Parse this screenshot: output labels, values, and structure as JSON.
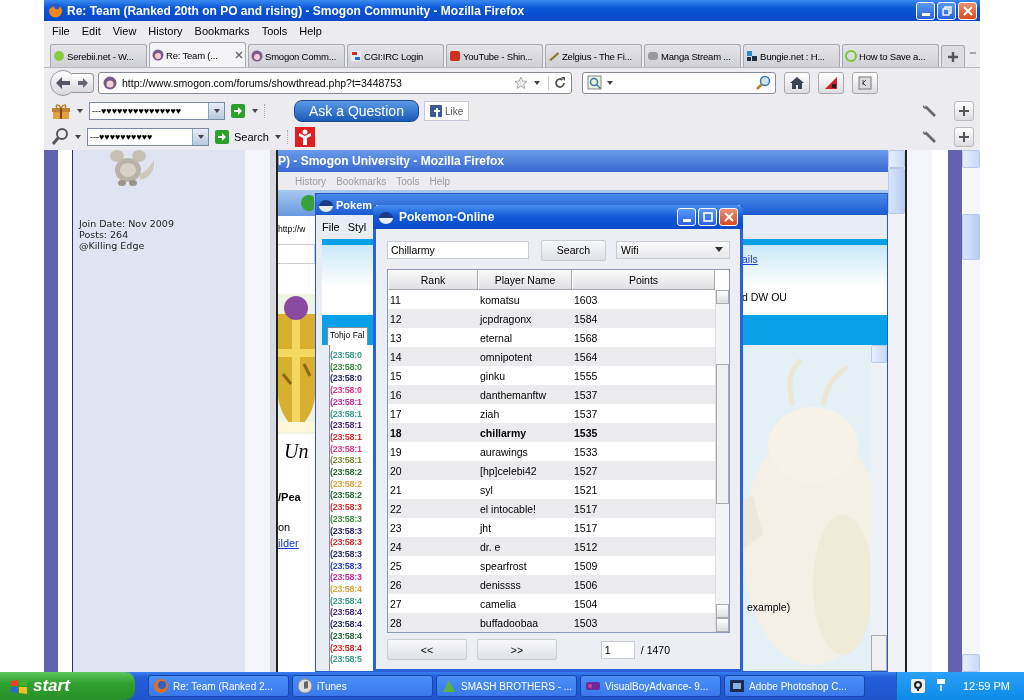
{
  "browser": {
    "title": "Re: Team (Ranked 20th on PO and rising) - Smogon Community - Mozilla Firefox",
    "menu": [
      "File",
      "Edit",
      "View",
      "History",
      "Bookmarks",
      "Tools",
      "Help"
    ],
    "tabs": [
      {
        "label": "Serebii.net - W...",
        "selected": false
      },
      {
        "label": "Re: Team (...",
        "selected": true
      },
      {
        "label": "Smogon Comm...",
        "selected": false
      },
      {
        "label": "CGI:IRC Login",
        "selected": false
      },
      {
        "label": "YouTube - Shin...",
        "selected": false
      },
      {
        "label": "Zelgius - The Fi...",
        "selected": false
      },
      {
        "label": "Manga Stream ...",
        "selected": false
      },
      {
        "label": "Bungie.net : H...",
        "selected": false
      },
      {
        "label": "How to Save a...",
        "selected": false
      }
    ],
    "address": "http://www.smogon.com/forums/showthread.php?t=3448753",
    "toolbar_1": {
      "dropdown": "---♥♥♥♥♥♥♥♥♥♥♥♥♥♥♥",
      "ask_button": "Ask a Question",
      "like_button": "Like"
    },
    "toolbar_2": {
      "dropdown": "---♥♥♥♥♥♥♥♥♥♥",
      "search_button": "Search"
    }
  },
  "post": {
    "user_info": [
      "Join Date: Nov 2009",
      "Posts: 264",
      "@Killing Edge"
    ]
  },
  "inner_browser": {
    "title": "P) - Smogon University - Mozilla Firefox",
    "menu": [
      "History",
      "Bookmarks",
      "Tools",
      "Help"
    ],
    "fragments": [
      {
        "kind": "url",
        "text": "http://w"
      },
      {
        "kind": "heading",
        "text": "Un"
      },
      {
        "kind": "bold",
        "text": "/Pea"
      },
      {
        "kind": "text",
        "text": "on"
      },
      {
        "kind": "link",
        "text": "ilder"
      }
    ]
  },
  "client_window": {
    "title": "Pokem",
    "menu": [
      "File",
      "Styl"
    ],
    "link": "ails",
    "tier_text": "d DW OU",
    "chat_tab": "Tohjo Fal",
    "chat_text": "example)",
    "chat_log": [
      {
        "text": "(23:58:0",
        "color": "#3a9a8a"
      },
      {
        "text": "(23:58:0",
        "color": "#3d8a3d"
      },
      {
        "text": "(23:58:0",
        "color": "#2a2a6a"
      },
      {
        "text": "(23:58:0",
        "color": "#d83a8a"
      },
      {
        "text": "(23:58:1",
        "color": "#c02f9a"
      },
      {
        "text": "(23:58:1",
        "color": "#3a9a8a"
      },
      {
        "text": "(23:58:1",
        "color": "#4a2a7a"
      },
      {
        "text": "(23:58:1",
        "color": "#d03030"
      },
      {
        "text": "(23:58:1",
        "color": "#d83a8a"
      },
      {
        "text": "(23:58:1",
        "color": "#7a8a3a"
      },
      {
        "text": "(23:58:2",
        "color": "#2a6a3a"
      },
      {
        "text": "(23:58:2",
        "color": "#d8a840"
      },
      {
        "text": "(23:58:2",
        "color": "#2a6a3a"
      },
      {
        "text": "(23:58:3",
        "color": "#d03030"
      },
      {
        "text": "(23:58:3",
        "color": "#3d8a3d"
      },
      {
        "text": "(23:58:3",
        "color": "#2a2a6a"
      },
      {
        "text": "(23:58:3",
        "color": "#d03030"
      },
      {
        "text": "(23:58:3",
        "color": "#2a2a6a"
      },
      {
        "text": "(23:58:3",
        "color": "#3040c0"
      },
      {
        "text": "(23:58:3",
        "color": "#c02f9a"
      },
      {
        "text": "(23:58:4",
        "color": "#d8a840"
      },
      {
        "text": "(23:58:4",
        "color": "#3a9a8a"
      },
      {
        "text": "(23:58:4",
        "color": "#4a2a7a"
      },
      {
        "text": "(23:58:4",
        "color": "#2a2a6a"
      },
      {
        "text": "(23:58:4",
        "color": "#2a6a3a"
      },
      {
        "text": "(23:58:4",
        "color": "#d03030"
      },
      {
        "text": "(23:58:5",
        "color": "#3a9a8a"
      }
    ]
  },
  "ladder_window": {
    "title": "Pokemon-Online",
    "search_value": "Chillarmy",
    "search_button": "Search",
    "tier": "Wifi",
    "columns": [
      "Rank",
      "Player Name",
      "Points"
    ],
    "rows": [
      {
        "rank": "11",
        "name": "komatsu",
        "points": "1603",
        "selected": false
      },
      {
        "rank": "12",
        "name": "jcpdragonx",
        "points": "1584",
        "selected": false
      },
      {
        "rank": "13",
        "name": "eternal",
        "points": "1568",
        "selected": false
      },
      {
        "rank": "14",
        "name": "omnipotent",
        "points": "1564",
        "selected": false
      },
      {
        "rank": "15",
        "name": "ginku",
        "points": "1555",
        "selected": false
      },
      {
        "rank": "16",
        "name": "danthemanftw",
        "points": "1537",
        "selected": false
      },
      {
        "rank": "17",
        "name": "ziah",
        "points": "1537",
        "selected": false
      },
      {
        "rank": "18",
        "name": "chillarmy",
        "points": "1535",
        "selected": true
      },
      {
        "rank": "19",
        "name": "aurawings",
        "points": "1533",
        "selected": false
      },
      {
        "rank": "20",
        "name": "[hp]celebi42",
        "points": "1527",
        "selected": false
      },
      {
        "rank": "21",
        "name": "syl",
        "points": "1521",
        "selected": false
      },
      {
        "rank": "22",
        "name": "el intocable!",
        "points": "1517",
        "selected": false
      },
      {
        "rank": "23",
        "name": "jht",
        "points": "1517",
        "selected": false
      },
      {
        "rank": "24",
        "name": "dr. e",
        "points": "1512",
        "selected": false
      },
      {
        "rank": "25",
        "name": "spearfrost",
        "points": "1509",
        "selected": false
      },
      {
        "rank": "26",
        "name": "denissss",
        "points": "1506",
        "selected": false
      },
      {
        "rank": "27",
        "name": "camelia",
        "points": "1504",
        "selected": false
      },
      {
        "rank": "28",
        "name": "buffadoobaa",
        "points": "1503",
        "selected": false
      }
    ],
    "prev_button": "<<",
    "next_button": ">>",
    "page": "1",
    "page_total": "/ 1470"
  },
  "taskbar": {
    "start": "start",
    "items": [
      "Re: Team (Ranked 2...",
      "iTunes",
      "SMASH BROTHERS - ...",
      "VisualBoyAdvance- 9...",
      "Adobe Photoshop C..."
    ],
    "clock": "12:59 PM"
  }
}
